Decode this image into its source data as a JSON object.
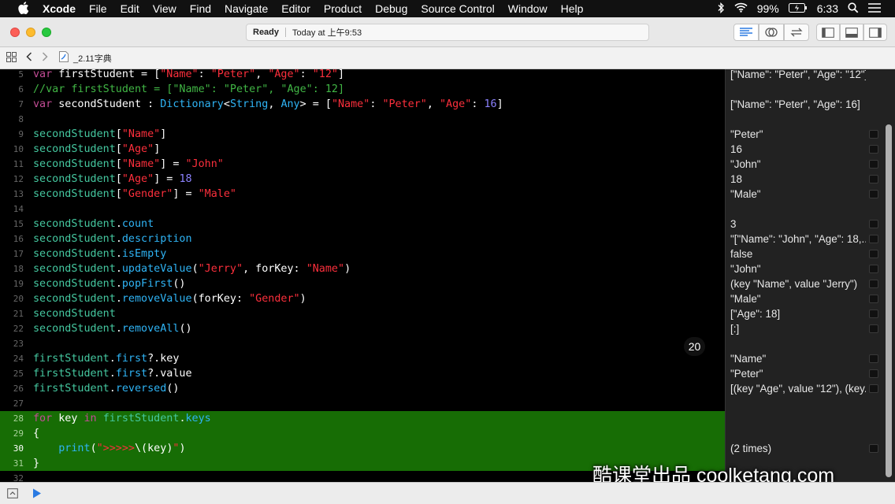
{
  "menubar": {
    "apple_icon": "apple-logo-icon",
    "app_name": "Xcode",
    "menus": [
      "File",
      "Edit",
      "View",
      "Find",
      "Navigate",
      "Editor",
      "Product",
      "Debug",
      "Source Control",
      "Window",
      "Help"
    ],
    "battery": "99%",
    "time": "6:33"
  },
  "toolbar": {
    "status": "Ready",
    "timestamp": "Today at 上午9:53"
  },
  "jumpbar": {
    "file": "_2.11字典"
  },
  "editor": {
    "lines": [
      {
        "num": "5",
        "tokens": [
          [
            "kw",
            "var "
          ],
          [
            "plain",
            "firstStudent = "
          ],
          [
            "bracket",
            "["
          ],
          [
            "str",
            "\"Name\""
          ],
          [
            "plain",
            ": "
          ],
          [
            "str",
            "\"Peter\""
          ],
          [
            "plain",
            ", "
          ],
          [
            "str",
            "\"Age\""
          ],
          [
            "plain",
            ": "
          ],
          [
            "str",
            "\"12\""
          ],
          [
            "bracket",
            "]"
          ]
        ]
      },
      {
        "num": "6",
        "tokens": [
          [
            "cmt",
            "//var firstStudent = [\"Name\": \"Peter\", \"Age\": 12]"
          ]
        ]
      },
      {
        "num": "7",
        "tokens": [
          [
            "kw",
            "var "
          ],
          [
            "plain",
            "secondStudent : "
          ],
          [
            "type",
            "Dictionary"
          ],
          [
            "plain",
            "<"
          ],
          [
            "type",
            "String"
          ],
          [
            "plain",
            ", "
          ],
          [
            "type",
            "Any"
          ],
          [
            "plain",
            "> = ["
          ],
          [
            "str",
            "\"Name\""
          ],
          [
            "plain",
            ": "
          ],
          [
            "str",
            "\"Peter\""
          ],
          [
            "plain",
            ", "
          ],
          [
            "str",
            "\"Age\""
          ],
          [
            "plain",
            ": "
          ],
          [
            "num",
            "16"
          ],
          [
            "plain",
            "]"
          ]
        ]
      },
      {
        "num": "8",
        "tokens": []
      },
      {
        "num": "9",
        "tokens": [
          [
            "var",
            "secondStudent"
          ],
          [
            "plain",
            "["
          ],
          [
            "str",
            "\"Name\""
          ],
          [
            "plain",
            "]"
          ]
        ]
      },
      {
        "num": "10",
        "tokens": [
          [
            "var",
            "secondStudent"
          ],
          [
            "plain",
            "["
          ],
          [
            "str",
            "\"Age\""
          ],
          [
            "plain",
            "]"
          ]
        ]
      },
      {
        "num": "11",
        "tokens": [
          [
            "var",
            "secondStudent"
          ],
          [
            "plain",
            "["
          ],
          [
            "str",
            "\"Name\""
          ],
          [
            "plain",
            "] = "
          ],
          [
            "str",
            "\"John\""
          ]
        ]
      },
      {
        "num": "12",
        "tokens": [
          [
            "var",
            "secondStudent"
          ],
          [
            "plain",
            "["
          ],
          [
            "str",
            "\"Age\""
          ],
          [
            "plain",
            "] = "
          ],
          [
            "num",
            "18"
          ]
        ]
      },
      {
        "num": "13",
        "tokens": [
          [
            "var",
            "secondStudent"
          ],
          [
            "plain",
            "["
          ],
          [
            "str",
            "\"Gender\""
          ],
          [
            "plain",
            "] = "
          ],
          [
            "str",
            "\"Male\""
          ]
        ]
      },
      {
        "num": "14",
        "tokens": []
      },
      {
        "num": "15",
        "tokens": [
          [
            "var",
            "secondStudent"
          ],
          [
            "plain",
            "."
          ],
          [
            "prop",
            "count"
          ]
        ]
      },
      {
        "num": "16",
        "tokens": [
          [
            "var",
            "secondStudent"
          ],
          [
            "plain",
            "."
          ],
          [
            "prop",
            "description"
          ]
        ]
      },
      {
        "num": "17",
        "tokens": [
          [
            "var",
            "secondStudent"
          ],
          [
            "plain",
            "."
          ],
          [
            "prop",
            "isEmpty"
          ]
        ]
      },
      {
        "num": "18",
        "tokens": [
          [
            "var",
            "secondStudent"
          ],
          [
            "plain",
            "."
          ],
          [
            "prop",
            "updateValue"
          ],
          [
            "plain",
            "("
          ],
          [
            "str",
            "\"Jerry\""
          ],
          [
            "plain",
            ", forKey: "
          ],
          [
            "str",
            "\"Name\""
          ],
          [
            "plain",
            ")"
          ]
        ]
      },
      {
        "num": "19",
        "tokens": [
          [
            "var",
            "secondStudent"
          ],
          [
            "plain",
            "."
          ],
          [
            "prop",
            "popFirst"
          ],
          [
            "plain",
            "()"
          ]
        ]
      },
      {
        "num": "20",
        "tokens": [
          [
            "var",
            "secondStudent"
          ],
          [
            "plain",
            "."
          ],
          [
            "prop",
            "removeValue"
          ],
          [
            "plain",
            "(forKey: "
          ],
          [
            "str",
            "\"Gender\""
          ],
          [
            "plain",
            ")"
          ]
        ]
      },
      {
        "num": "21",
        "tokens": [
          [
            "var",
            "secondStudent"
          ]
        ]
      },
      {
        "num": "22",
        "tokens": [
          [
            "var",
            "secondStudent"
          ],
          [
            "plain",
            "."
          ],
          [
            "prop",
            "removeAll"
          ],
          [
            "plain",
            "()"
          ]
        ]
      },
      {
        "num": "23",
        "tokens": []
      },
      {
        "num": "24",
        "tokens": [
          [
            "var",
            "firstStudent"
          ],
          [
            "plain",
            "."
          ],
          [
            "prop",
            "first"
          ],
          [
            "plain",
            "?.key"
          ]
        ]
      },
      {
        "num": "25",
        "tokens": [
          [
            "var",
            "firstStudent"
          ],
          [
            "plain",
            "."
          ],
          [
            "prop",
            "first"
          ],
          [
            "plain",
            "?.value"
          ]
        ]
      },
      {
        "num": "26",
        "tokens": [
          [
            "var",
            "firstStudent"
          ],
          [
            "plain",
            "."
          ],
          [
            "prop",
            "reversed"
          ],
          [
            "plain",
            "()"
          ]
        ]
      },
      {
        "num": "27",
        "tokens": []
      },
      {
        "num": "28",
        "tokens": [
          [
            "kw",
            "for "
          ],
          [
            "plain",
            "key "
          ],
          [
            "kw",
            "in "
          ],
          [
            "var",
            "firstStudent"
          ],
          [
            "plain",
            "."
          ],
          [
            "prop",
            "keys"
          ]
        ]
      },
      {
        "num": "29",
        "tokens": [
          [
            "plain",
            "{"
          ]
        ]
      },
      {
        "num": "30",
        "tokens": [
          [
            "plain",
            "    "
          ],
          [
            "prop",
            "print"
          ],
          [
            "plain",
            "("
          ],
          [
            "str",
            "\">>>>>"
          ],
          [
            "plain",
            "\\("
          ],
          [
            "plain",
            "key"
          ],
          [
            "plain",
            ")"
          ],
          [
            "str",
            "\""
          ],
          [
            "plain",
            ")"
          ]
        ]
      },
      {
        "num": "31",
        "tokens": [
          [
            "plain",
            "}"
          ]
        ]
      },
      {
        "num": "32",
        "tokens": []
      }
    ],
    "badge": "20"
  },
  "results": [
    {
      "text": "[\"Name\": \"Peter\", \"Age\": \"12\"]",
      "box": false
    },
    {
      "text": "",
      "box": false
    },
    {
      "text": "[\"Name\": \"Peter\", \"Age\": 16]",
      "box": false
    },
    {
      "text": "",
      "box": false
    },
    {
      "text": "\"Peter\"",
      "box": true
    },
    {
      "text": "16",
      "box": true
    },
    {
      "text": "\"John\"",
      "box": true
    },
    {
      "text": "18",
      "box": true
    },
    {
      "text": "\"Male\"",
      "box": true
    },
    {
      "text": "",
      "box": false
    },
    {
      "text": "3",
      "box": true
    },
    {
      "text": "\"[\"Name\": \"John\", \"Age\": 18,...",
      "box": true
    },
    {
      "text": "false",
      "box": true
    },
    {
      "text": "\"John\"",
      "box": true
    },
    {
      "text": "(key \"Name\", value \"Jerry\")",
      "box": true
    },
    {
      "text": "\"Male\"",
      "box": true
    },
    {
      "text": "[\"Age\": 18]",
      "box": true
    },
    {
      "text": "[:]",
      "box": true
    },
    {
      "text": "",
      "box": false
    },
    {
      "text": "\"Name\"",
      "box": true
    },
    {
      "text": "\"Peter\"",
      "box": true
    },
    {
      "text": "[(key \"Age\", value \"12\"), (key...",
      "box": true
    },
    {
      "text": "",
      "box": false
    },
    {
      "text": "",
      "box": false
    },
    {
      "text": "",
      "box": false
    },
    {
      "text": "(2 times)",
      "box": true
    },
    {
      "text": "",
      "box": false
    },
    {
      "text": "",
      "box": false
    }
  ],
  "watermark": "酷课堂出品 coolketang.com",
  "colors": {
    "keyword": "#c34c96",
    "variable": "#45c8a0",
    "string": "#fc2f3c",
    "number": "#8c82ff",
    "method": "#2fb4f5",
    "comment": "#41b645",
    "highlight": "#176d05"
  }
}
